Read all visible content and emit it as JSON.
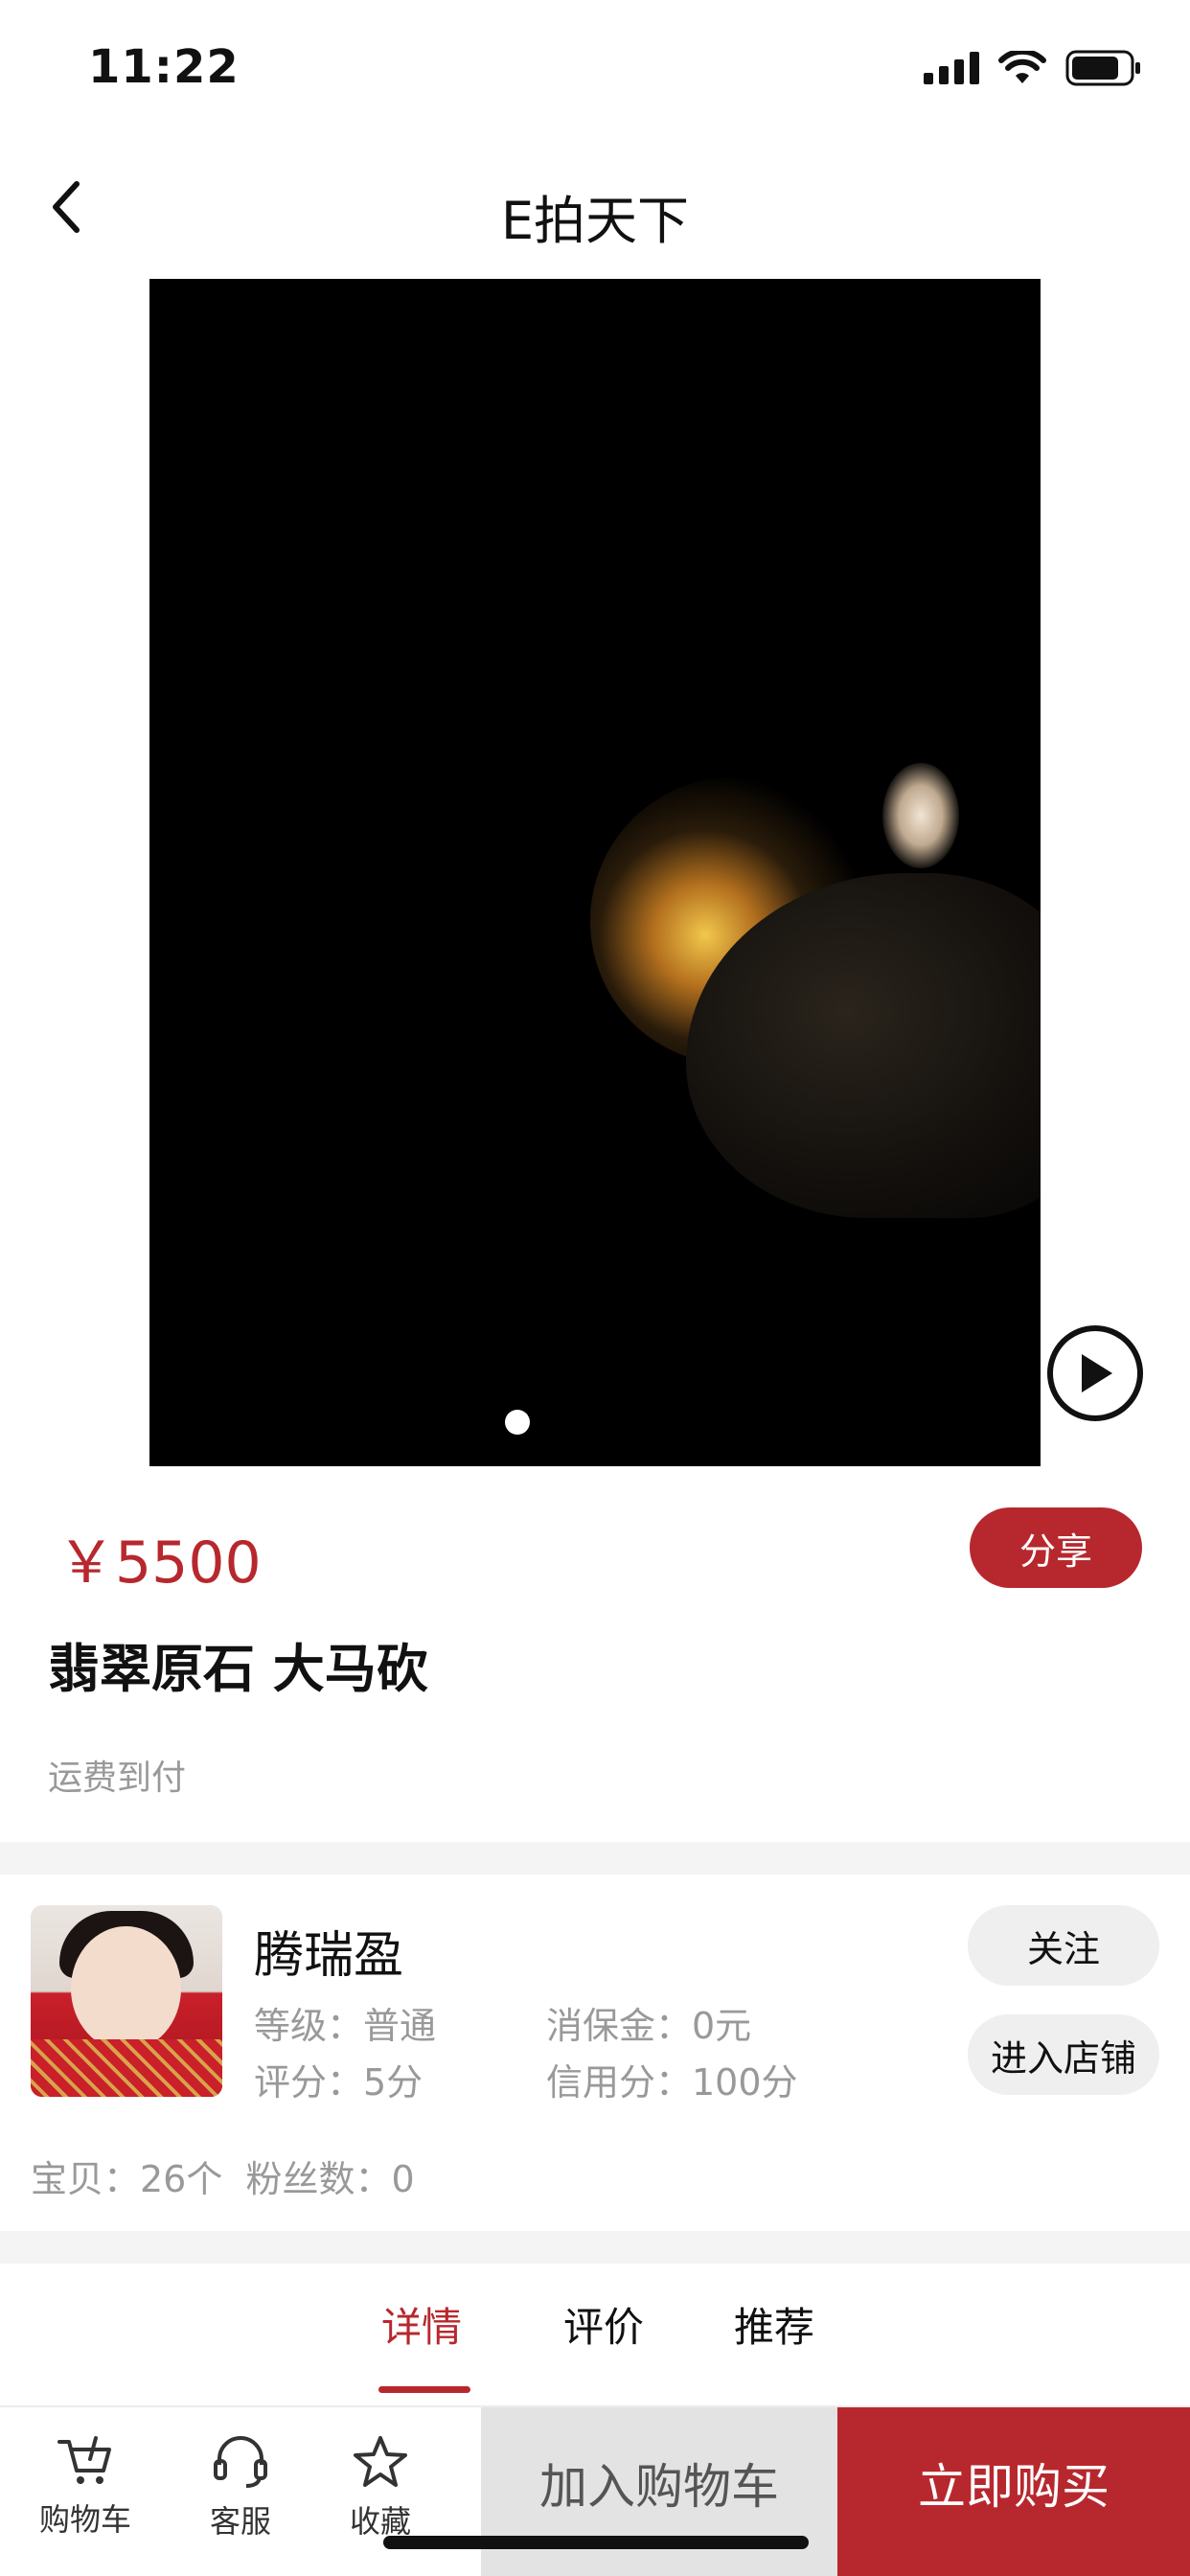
{
  "status_bar": {
    "time": "11:22"
  },
  "nav": {
    "title": "E拍天下"
  },
  "product": {
    "price": "￥5500",
    "share_label": "分享",
    "title": "翡翠原石 大马砍",
    "shipping": "运费到付"
  },
  "seller": {
    "name": "腾瑞盈",
    "level": "等级：普通",
    "deposit": "消保金：0元",
    "rating": "评分：5分",
    "credit": "信用分：100分",
    "follow_label": "关注",
    "enter_store_label": "进入店铺",
    "items_count": "宝贝：26个",
    "fans_count": "粉丝数：0"
  },
  "tabs": [
    {
      "label": "详情",
      "active": true
    },
    {
      "label": "评价",
      "active": false
    },
    {
      "label": "推荐",
      "active": false
    }
  ],
  "bottom_bar": {
    "cart_label": "购物车",
    "service_label": "客服",
    "favorite_label": "收藏",
    "add_to_cart_label": "加入购物车",
    "buy_now_label": "立即购买"
  },
  "colors": {
    "accent": "#b7282e",
    "muted_text": "#999999",
    "button_gray": "#efefef"
  },
  "icons": [
    "signal-icon",
    "wifi-icon",
    "battery-icon",
    "back-arrow-icon",
    "play-icon",
    "cart-icon",
    "headset-icon",
    "star-icon"
  ]
}
